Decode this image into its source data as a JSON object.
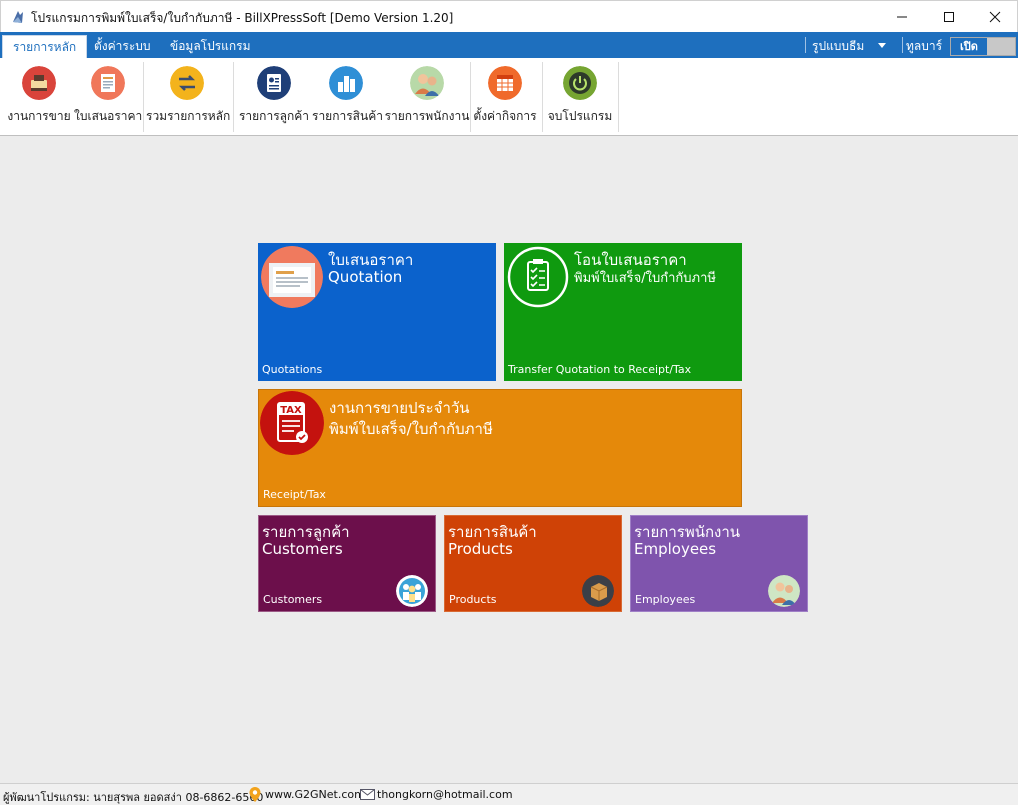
{
  "window": {
    "title": "โปรแกรมการพิมพ์ใบเสร็จ/ใบกำกับภาษี - BillXPressSoft [Demo Version 1.20]"
  },
  "menubar": {
    "tabs": [
      "รายการหลัก",
      "ตั้งค่าระบบ",
      "ข้อมูลโปรแกรม"
    ],
    "theme_label": "รูปแบบธีม",
    "toolbar_label": "ทูลบาร์",
    "toggle_label": "เปิด"
  },
  "ribbon": {
    "buttons": [
      {
        "label": "งานการขาย",
        "icon": "cash-register-icon"
      },
      {
        "label": "ใบเสนอราคา",
        "icon": "quotation-icon"
      },
      {
        "label": "รวมรายการหลัก",
        "icon": "transfer-icon"
      },
      {
        "label": "รายการลูกค้า",
        "icon": "customer-card-icon"
      },
      {
        "label": "รายการสินค้า",
        "icon": "products-icon"
      },
      {
        "label": "รายการพนักงาน",
        "icon": "employees-icon"
      },
      {
        "label": "ตั้งค่ากิจการ",
        "icon": "company-settings-icon"
      },
      {
        "label": "จบโปรแกรม",
        "icon": "power-icon"
      }
    ]
  },
  "tiles": {
    "quotation": {
      "line1": "ใบเสนอราคา",
      "line2": "Quotation",
      "footer": "Quotations",
      "color": "#0b62cc"
    },
    "transfer": {
      "line1": "โอนใบเสนอราคา",
      "line2": "พิมพ์ใบเสร็จ/ใบกำกับภาษี",
      "footer": "Transfer Quotation to Receipt/Tax",
      "color": "#0f9a0f"
    },
    "receipt": {
      "line1": "งานการขายประจำวัน",
      "line2": "พิมพ์ใบเสร็จ/ใบกำกับภาษี",
      "footer": "Receipt/Tax",
      "badge_text": "TAX",
      "color": "#e5890a"
    },
    "customers": {
      "line1": "รายการลูกค้า",
      "line2": "Customers",
      "footer": "Customers",
      "color": "#6c0f4b"
    },
    "products": {
      "line1": "รายการสินค้า",
      "line2": "Products",
      "footer": "Products",
      "color": "#cf4206"
    },
    "employees": {
      "line1": "รายการพนักงาน",
      "line2": "Employees",
      "footer": "Employees",
      "color": "#7f54ad"
    }
  },
  "statusbar": {
    "developer": "ผู้พัฒนาโปรแกรม: นายสุรพล ยอดสง่า 08-6862-6560",
    "website": "www.G2GNet.com",
    "email": "thongkorn@hotmail.com"
  }
}
